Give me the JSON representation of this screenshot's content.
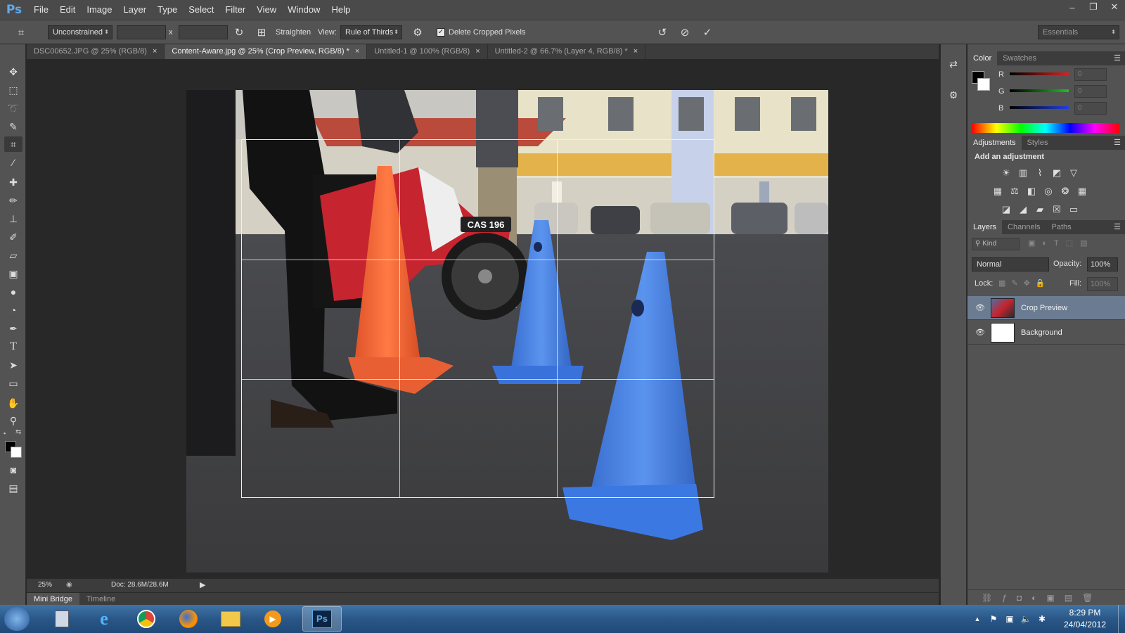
{
  "app": {
    "logo": "Ps",
    "menu": [
      "File",
      "Edit",
      "Image",
      "Layer",
      "Type",
      "Select",
      "Filter",
      "View",
      "Window",
      "Help"
    ]
  },
  "window_controls": {
    "minimize": "–",
    "restore": "❐",
    "close": "✕"
  },
  "options_bar": {
    "ratio_preset": "Unconstrained",
    "width_value": "",
    "height_value": "",
    "x_sep": "x",
    "straighten_label": "Straighten",
    "view_label": "View:",
    "view_value": "Rule of Thirds",
    "delete_cropped_label": "Delete Cropped Pixels",
    "delete_cropped_checked": true,
    "workspace": "Essentials"
  },
  "doc_tabs": [
    {
      "label": "DSC00652.JPG @ 25% (RGB/8)",
      "active": false
    },
    {
      "label": "Content-Aware.jpg @ 25% (Crop Preview, RGB/8) *",
      "active": true
    },
    {
      "label": "Untitled-1 @ 100% (RGB/8)",
      "active": false
    },
    {
      "label": "Untitled-2 @ 66.7% (Layer 4, RGB/8) *",
      "active": false
    }
  ],
  "photo": {
    "plate_text": "CAS 196"
  },
  "status": {
    "zoom": "25%",
    "doc_info": "Doc: 28.6M/28.6M"
  },
  "bottom_tabs": [
    "Mini Bridge",
    "Timeline"
  ],
  "color_panel": {
    "tabs": [
      "Color",
      "Swatches"
    ],
    "channels": [
      {
        "label": "R",
        "value": "0",
        "color": "#e02020"
      },
      {
        "label": "G",
        "value": "0",
        "color": "#20c020"
      },
      {
        "label": "B",
        "value": "0",
        "color": "#2040e0"
      }
    ]
  },
  "adjustments_panel": {
    "tabs": [
      "Adjustments",
      "Styles"
    ],
    "heading": "Add an adjustment"
  },
  "layers_panel": {
    "tabs": [
      "Layers",
      "Channels",
      "Paths"
    ],
    "filter_kind": "Kind",
    "blend_mode": "Normal",
    "opacity_label": "Opacity:",
    "opacity_value": "100%",
    "lock_label": "Lock:",
    "fill_label": "Fill:",
    "fill_value": "100%",
    "layers": [
      {
        "name": "Crop Preview",
        "selected": true
      },
      {
        "name": "Background",
        "selected": false
      }
    ]
  },
  "taskbar": {
    "time": "8:29 PM",
    "date": "24/04/2012"
  },
  "colors": {
    "accent_blue": "#4a82e0",
    "cone_orange": "#f06a3a",
    "ps_blue": "#5fa9e8"
  }
}
